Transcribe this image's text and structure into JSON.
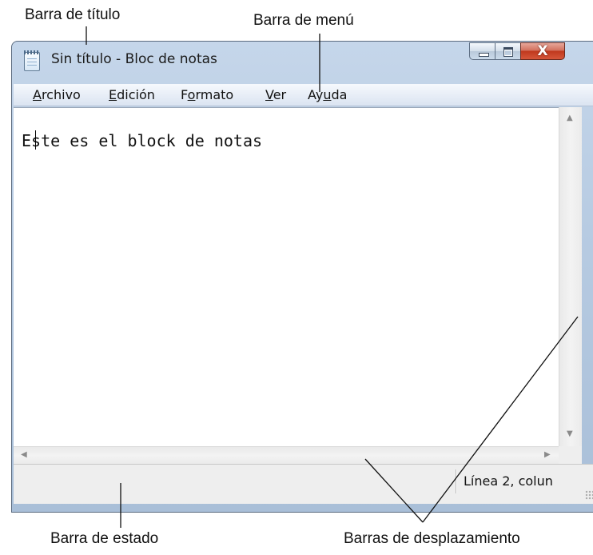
{
  "annotations": {
    "title_bar": "Barra de título",
    "menu_bar": "Barra de menú",
    "status_bar": "Barra de estado",
    "scroll_bars": "Barras de desplazamiento"
  },
  "window": {
    "title": "Sin título - Bloc de notas",
    "close_glyph": "X"
  },
  "menu": {
    "archivo": {
      "key": "A",
      "rest": "rchivo"
    },
    "edicion": {
      "key": "E",
      "rest": "dición"
    },
    "formato": {
      "pre": "F",
      "key": "o",
      "rest": "rmato"
    },
    "ver": {
      "key": "V",
      "rest": "er"
    },
    "ayuda": {
      "pre": "Ay",
      "key": "u",
      "rest": "da"
    }
  },
  "editor": {
    "content": "Este es el block de notas"
  },
  "status": {
    "position": "Línea 2, colun"
  },
  "icons": {
    "app": "notepad-icon",
    "minimize": "minimize-icon",
    "maximize": "maximize-icon",
    "close": "close-icon"
  }
}
